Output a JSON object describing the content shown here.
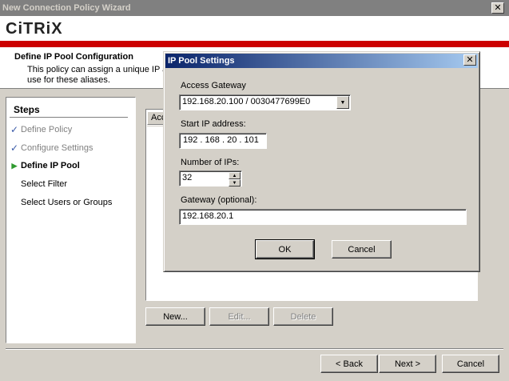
{
  "window": {
    "title": "New Connection Policy Wizard",
    "close_glyph": "✕"
  },
  "branding": {
    "logo_text": "CiTRiX"
  },
  "page": {
    "title": "Define IP Pool Configuration",
    "description": "This policy can assign a unique IP a use for these aliases."
  },
  "steps": {
    "title": "Steps",
    "items": [
      {
        "label": "Define Policy",
        "state": "done",
        "mark": "✓"
      },
      {
        "label": "Configure Settings",
        "state": "done",
        "mark": "✓"
      },
      {
        "label": "Define IP Pool",
        "state": "current",
        "mark": "▶"
      },
      {
        "label": "Select Filter",
        "state": "pending",
        "mark": ""
      },
      {
        "label": "Select Users or Groups",
        "state": "pending",
        "mark": ""
      }
    ]
  },
  "list": {
    "column_header": "Acc"
  },
  "list_buttons": {
    "new": "New...",
    "edit": "Edit...",
    "delete": "Delete"
  },
  "nav_buttons": {
    "back": "< Back",
    "next": "Next >",
    "cancel": "Cancel"
  },
  "dialog": {
    "title": "IP Pool Settings",
    "close_glyph": "✕",
    "access_gateway_label": "Access Gateway",
    "access_gateway_value": "192.168.20.100 / 0030477699E0",
    "start_ip_label": "Start IP address:",
    "start_ip_octets": [
      "192",
      "168",
      "20",
      "101"
    ],
    "num_ips_label": "Number of IPs:",
    "num_ips_value": "32",
    "gateway_label": "Gateway (optional):",
    "gateway_value": "192.168.20.1",
    "ok_label": "OK",
    "cancel_label": "Cancel"
  },
  "colors": {
    "brand_red": "#cc0000",
    "dialog_title_start": "#0a246a",
    "dialog_title_end": "#a6caf0",
    "check_mark": "#3a5aa8",
    "current_arrow": "#2f9a2f"
  },
  "icons": {
    "window_close": "close-icon",
    "dialog_close": "close-icon",
    "combo_arrow": "chevron-down-icon",
    "spin_up": "spin-up-icon",
    "spin_down": "spin-down-icon"
  }
}
